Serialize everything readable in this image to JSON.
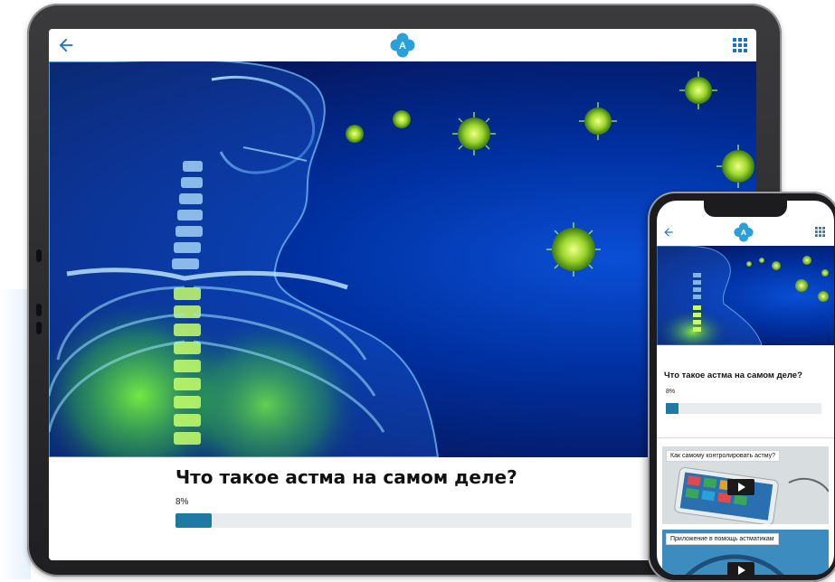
{
  "tablet": {
    "title": "Что такое астма на самом деле?",
    "progress_text": "8%",
    "progress": 0.08,
    "logo_letter": "A",
    "icons": {
      "back": "arrow-left-icon",
      "menu": "grid-menu-icon"
    }
  },
  "phone": {
    "title": "Что такое астма на самом деле?",
    "progress_text": "8%",
    "progress": 0.08,
    "logo_letter": "A",
    "cards": [
      {
        "label": "Как самому контролировать астму?"
      },
      {
        "label": "Приложение в помощь астматикам"
      }
    ]
  },
  "colors": {
    "accent": "#1f7aa3",
    "logo": "#2a9fd8",
    "hero": "#0030a0",
    "virus": "#9ad62c"
  }
}
